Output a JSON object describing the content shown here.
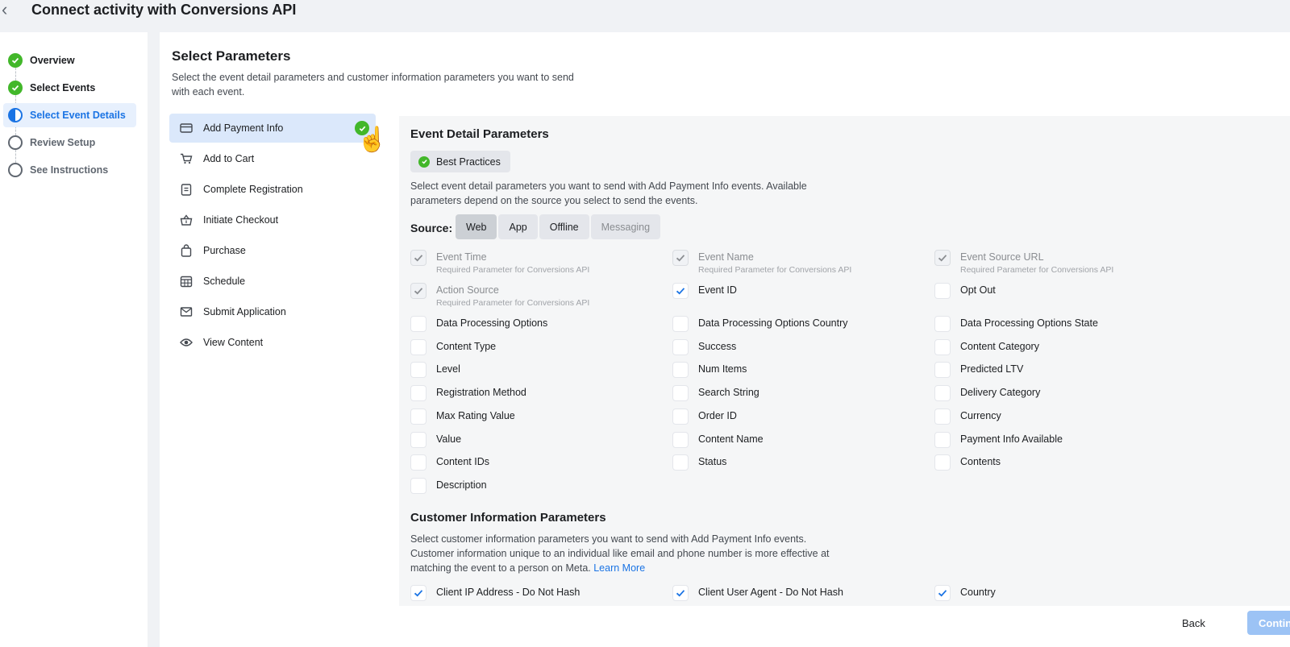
{
  "header": {
    "title": "Connect activity with Conversions API"
  },
  "stepper": {
    "steps": [
      {
        "label": "Overview",
        "state": "done"
      },
      {
        "label": "Select Events",
        "state": "done"
      },
      {
        "label": "Select Event Details",
        "state": "active"
      },
      {
        "label": "Review Setup",
        "state": "todo"
      },
      {
        "label": "See Instructions",
        "state": "todo"
      }
    ]
  },
  "main": {
    "title": "Select Parameters",
    "description": "Select the event detail parameters and customer information parameters you want to send with each event."
  },
  "events": [
    {
      "label": "Add Payment Info",
      "icon": "credit-card-icon",
      "selected": true
    },
    {
      "label": "Add to Cart",
      "icon": "cart-icon"
    },
    {
      "label": "Complete Registration",
      "icon": "clipboard-icon"
    },
    {
      "label": "Initiate Checkout",
      "icon": "basket-icon"
    },
    {
      "label": "Purchase",
      "icon": "shopping-bag-icon"
    },
    {
      "label": "Schedule",
      "icon": "calendar-icon"
    },
    {
      "label": "Submit Application",
      "icon": "envelope-icon"
    },
    {
      "label": "View Content",
      "icon": "eye-icon"
    }
  ],
  "event_details": {
    "title": "Event Detail Parameters",
    "best_practices": "Best Practices",
    "description": "Select event detail parameters you want to send with Add Payment Info events. Available parameters depend on the source you select to send the events.",
    "source_label": "Source:",
    "sources": [
      {
        "label": "Web",
        "active": true
      },
      {
        "label": "App"
      },
      {
        "label": "Offline"
      },
      {
        "label": "Messaging",
        "disabled": true
      }
    ],
    "required_note": "Required Parameter for Conversions API",
    "params": [
      {
        "label": "Event Time",
        "checked": true,
        "required": true
      },
      {
        "label": "Event Name",
        "checked": true,
        "required": true
      },
      {
        "label": "Event Source URL",
        "checked": true,
        "required": true
      },
      {
        "label": "Action Source",
        "checked": true,
        "required": true
      },
      {
        "label": "Event ID",
        "checked": true
      },
      {
        "label": "Opt Out",
        "checked": false
      },
      {
        "label": "Data Processing Options",
        "checked": false
      },
      {
        "label": "Data Processing Options Country",
        "checked": false
      },
      {
        "label": "Data Processing Options State",
        "checked": false
      },
      {
        "label": "Content Type",
        "checked": false
      },
      {
        "label": "Success",
        "checked": false
      },
      {
        "label": "Content Category",
        "checked": false
      },
      {
        "label": "Level",
        "checked": false
      },
      {
        "label": "Num Items",
        "checked": false
      },
      {
        "label": "Predicted LTV",
        "checked": false
      },
      {
        "label": "Registration Method",
        "checked": false
      },
      {
        "label": "Search String",
        "checked": false
      },
      {
        "label": "Delivery Category",
        "checked": false
      },
      {
        "label": "Max Rating Value",
        "checked": false
      },
      {
        "label": "Order ID",
        "checked": false
      },
      {
        "label": "Currency",
        "checked": false
      },
      {
        "label": "Value",
        "checked": false
      },
      {
        "label": "Content Name",
        "checked": false
      },
      {
        "label": "Payment Info Available",
        "checked": false
      },
      {
        "label": "Content IDs",
        "checked": false
      },
      {
        "label": "Status",
        "checked": false
      },
      {
        "label": "Contents",
        "checked": false
      },
      {
        "label": "Description",
        "checked": false
      }
    ]
  },
  "customer_info": {
    "title": "Customer Information Parameters",
    "description": "Select customer information parameters you want to send with Add Payment Info events. Customer information unique to an individual like email and phone number is more effective at matching the event to a person on Meta.",
    "learn_more": "Learn More",
    "params": [
      {
        "label": "Client IP Address - Do Not Hash",
        "checked": true
      },
      {
        "label": "Client User Agent - Do Not Hash",
        "checked": true
      },
      {
        "label": "Country",
        "checked": true
      }
    ]
  },
  "footer": {
    "back": "Back",
    "continue": "Continue"
  },
  "colors": {
    "accent": "#1b74e4",
    "success": "#42b72a"
  }
}
